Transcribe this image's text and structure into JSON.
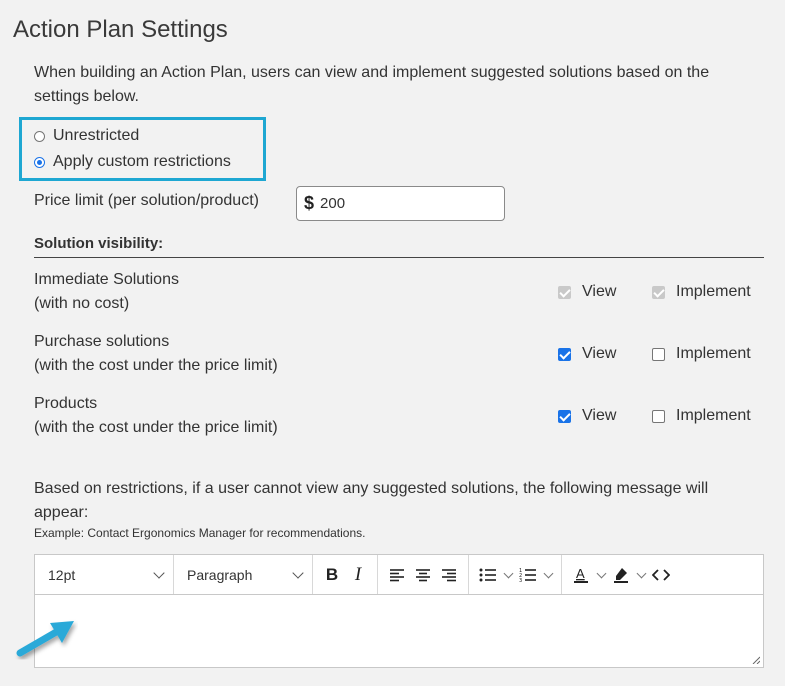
{
  "page": {
    "title": "Action Plan Settings",
    "intro": "When building an Action Plan, users can view and implement suggested solutions based on the settings below."
  },
  "restrictions": {
    "options": [
      {
        "label": "Unrestricted",
        "selected": false
      },
      {
        "label": "Apply custom restrictions",
        "selected": true
      }
    ]
  },
  "price_limit": {
    "label": "Price limit (per solution/product)",
    "currency_symbol": "$",
    "value": "200"
  },
  "visibility": {
    "title": "Solution visibility:",
    "view_label": "View",
    "implement_label": "Implement",
    "rows": [
      {
        "title": "Immediate Solutions",
        "subtitle": "(with no cost)",
        "view": "checked-disabled",
        "implement": "checked-disabled"
      },
      {
        "title": "Purchase solutions",
        "subtitle": "(with the cost under the price limit)",
        "view": "checked",
        "implement": "unchecked"
      },
      {
        "title": "Products",
        "subtitle": "(with the cost under the price limit)",
        "view": "checked",
        "implement": "unchecked"
      }
    ]
  },
  "message": {
    "text": "Based on restrictions, if a user cannot view any suggested solutions, the following message will appear:",
    "example": "Example: Contact Ergonomics Manager for recommendations."
  },
  "editor": {
    "font_size": "12pt",
    "block_format": "Paragraph",
    "content": ""
  },
  "colors": {
    "highlight": "#1ea7d2",
    "accent": "#1a73e8",
    "arrow": "#29a9d8"
  }
}
